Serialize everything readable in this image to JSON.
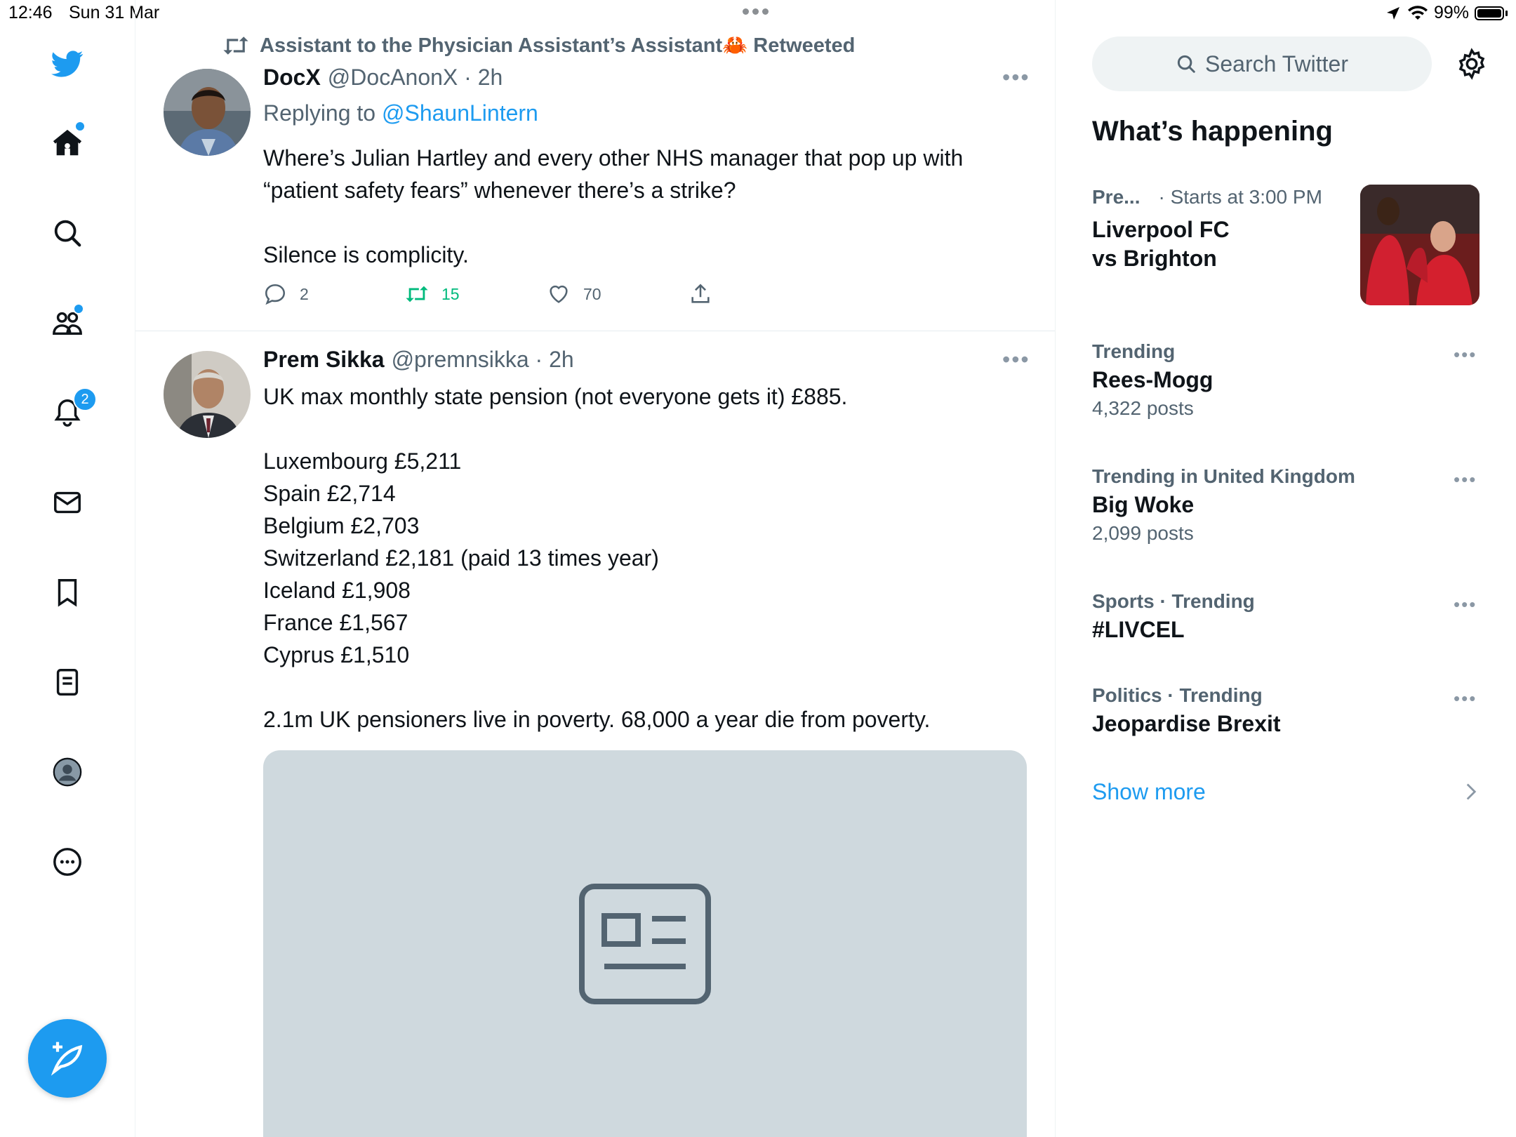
{
  "status_bar": {
    "time": "12:46",
    "date": "Sun 31 Mar",
    "battery": "99%"
  },
  "sidebar": {
    "notifications_badge": "2",
    "items": [
      {
        "icon": "twitter-logo-icon"
      },
      {
        "icon": "home-icon"
      },
      {
        "icon": "search-icon"
      },
      {
        "icon": "communities-icon"
      },
      {
        "icon": "notifications-bell-icon"
      },
      {
        "icon": "messages-envelope-icon"
      },
      {
        "icon": "bookmark-icon"
      },
      {
        "icon": "lists-icon"
      },
      {
        "icon": "profile-avatar-icon"
      },
      {
        "icon": "more-options-icon"
      }
    ],
    "compose_icon": "compose-feather-icon"
  },
  "feed": {
    "tweet1": {
      "retweeted_by": "Assistant to the Physician Assistant’s Assistant🦀 Retweeted",
      "name": "DocX",
      "handle": "@DocAnonX · 2h",
      "replying_prefix": "Replying to",
      "replying_to": "@ShaunLintern",
      "text_lines": [
        "Where’s Julian Hartley and every other NHS manager that pop up with",
        "“patient safety fears” whenever there’s a strike?",
        "",
        "Silence is complicity."
      ],
      "replies": "2",
      "retweets": "15",
      "likes": "70"
    },
    "tweet2": {
      "name": "Prem Sikka",
      "handle": "@premnsikka · 2h",
      "text_lines": [
        "UK max monthly state pension (not everyone gets it) £885.",
        "",
        "Luxembourg £5,211",
        "Spain £2,714",
        "Belgium £2,703",
        "Switzerland £2,181 (paid 13 times year)",
        "Iceland £1,908",
        "France £1,567",
        "Cyprus £1,510",
        "",
        "2.1m UK pensioners live in poverty. 68,000 a year die from poverty."
      ]
    }
  },
  "right": {
    "search_placeholder": "Search Twitter",
    "section_title": "What’s happening",
    "event": {
      "meta_left": "Pre...",
      "meta_right": "· Starts at 3:00 PM",
      "title_line1": "Liverpool FC",
      "title_line2": "vs Brighton"
    },
    "trends": [
      {
        "meta": "Trending",
        "name": "Rees-Mogg",
        "count": "4,322 posts"
      },
      {
        "meta": "Trending in United Kingdom",
        "name": "Big Woke",
        "count": "2,099 posts"
      },
      {
        "meta": "Sports · Trending",
        "name": "#LIVCEL",
        "count": ""
      },
      {
        "meta": "Politics · Trending",
        "name": "Jeopardise Brexit",
        "count": ""
      }
    ],
    "show_more": "Show more"
  },
  "colors": {
    "accent": "#1d9bf0",
    "retweet_green": "#00ba7c",
    "secondary_text": "#536471"
  }
}
